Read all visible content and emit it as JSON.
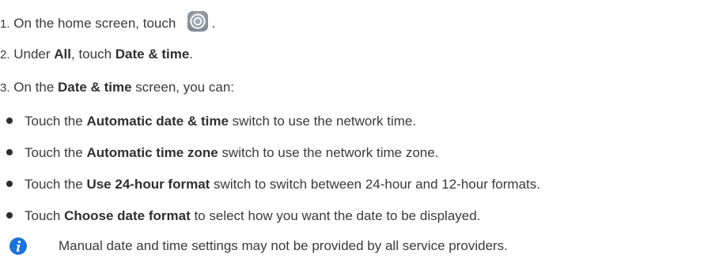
{
  "steps": [
    {
      "number": "1.",
      "text_before": " On the home screen, touch ",
      "text_after": " .",
      "icon": "settings-icon"
    },
    {
      "number": "2.",
      "text_1": " Under ",
      "bold_1": "All",
      "text_2": ", touch ",
      "bold_2": "Date & time",
      "text_3": "."
    },
    {
      "number": "3.",
      "text_1": " On the ",
      "bold_1": "Date & time",
      "text_2": " screen, you can:"
    }
  ],
  "bullets": [
    {
      "prefix": "Touch the ",
      "bold": "Automatic date & time",
      "suffix": " switch to use the network time."
    },
    {
      "prefix": "Touch the ",
      "bold": "Automatic time zone",
      "suffix": " switch to use the network time zone."
    },
    {
      "prefix": "Touch the ",
      "bold": "Use 24-hour format",
      "suffix": " switch to switch between 24-hour and 12-hour formats."
    },
    {
      "prefix": "Touch ",
      "bold": "Choose date format",
      "suffix": " to select how you want the date to be displayed."
    }
  ],
  "note": {
    "icon": "info-icon",
    "text": "Manual date and time settings may not be provided by all service providers."
  },
  "colors": {
    "text": "#3a3a3a",
    "info_icon": "#1e73d8",
    "settings_icon": "#8e959e"
  }
}
